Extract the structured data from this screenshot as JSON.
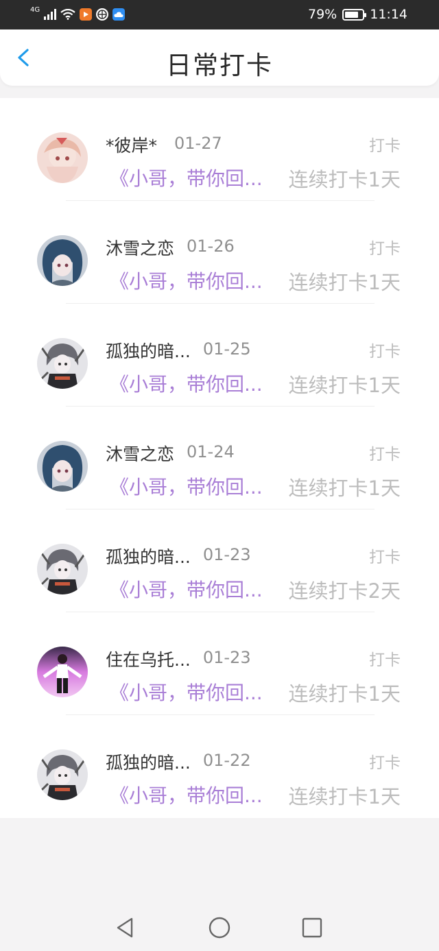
{
  "status_bar": {
    "network": "4G",
    "battery_percent": "79%",
    "battery_level": 0.79,
    "time": "11:14"
  },
  "header": {
    "title": "日常打卡",
    "back_icon": "chevron-left-icon",
    "accent_color": "#1e9bea"
  },
  "checkins": [
    {
      "name": "*彼岸*",
      "date": "01-27",
      "action": "打卡",
      "book": "《小哥，带你回...",
      "streak": "连续打卡1天",
      "avatar": "pink-anime"
    },
    {
      "name": "沐雪之恋",
      "date": "01-26",
      "action": "打卡",
      "book": "《小哥，带你回...",
      "streak": "连续打卡1天",
      "avatar": "blue-hair"
    },
    {
      "name": "孤独的暗...",
      "date": "01-25",
      "action": "打卡",
      "book": "《小哥，带你回...",
      "streak": "连续打卡1天",
      "avatar": "dark-anime"
    },
    {
      "name": "沐雪之恋",
      "date": "01-24",
      "action": "打卡",
      "book": "《小哥，带你回...",
      "streak": "连续打卡1天",
      "avatar": "blue-hair"
    },
    {
      "name": "孤独的暗...",
      "date": "01-23",
      "action": "打卡",
      "book": "《小哥，带你回...",
      "streak": "连续打卡2天",
      "avatar": "dark-anime"
    },
    {
      "name": "住在乌托...",
      "date": "01-23",
      "action": "打卡",
      "book": "《小哥，带你回...",
      "streak": "连续打卡1天",
      "avatar": "purple-figure"
    },
    {
      "name": "孤独的暗...",
      "date": "01-22",
      "action": "打卡",
      "book": "《小哥，带你回...",
      "streak": "连续打卡1天",
      "avatar": "dark-anime"
    }
  ],
  "colors": {
    "book_title": "#a97ed6",
    "muted": "#bcbcbc",
    "name": "#333333"
  },
  "nav_bar": {
    "back": "triangle-back-icon",
    "home": "circle-home-icon",
    "recents": "square-recents-icon"
  }
}
